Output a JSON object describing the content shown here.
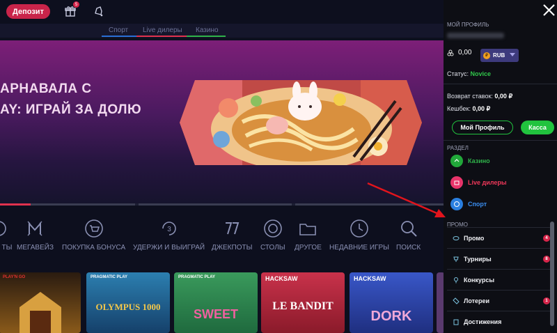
{
  "topbar": {
    "deposit_label": "Депозит",
    "gift_badge": "5"
  },
  "tabs": [
    {
      "label": "Спорт",
      "color": "#2a6fd6"
    },
    {
      "label": "Live дилеры",
      "color": "#e0324e"
    },
    {
      "label": "Казино",
      "color": "#2fb34a"
    }
  ],
  "banner": {
    "title_line1": "АРНАВАЛА С",
    "title_line2": "AY: ИГРАЙ ЗА ДОЛЮ"
  },
  "categories": [
    {
      "label": "ТЫ",
      "icon": "partial-icon"
    },
    {
      "label": "МЕГАВЕЙЗ",
      "icon": "megaways-icon"
    },
    {
      "label": "ПОКУПКА БОНУСА",
      "icon": "bonus-buy-icon"
    },
    {
      "label": "УДЕРЖИ И ВЫИГРАЙ",
      "icon": "hold-and-win-icon"
    },
    {
      "label": "ДЖЕКПОТЫ",
      "icon": "jackpot-icon"
    },
    {
      "label": "СТОЛЫ",
      "icon": "tables-icon"
    },
    {
      "label": "ДРУГОЕ",
      "icon": "folder-icon"
    },
    {
      "label": "НЕДАВНИЕ ИГРЫ",
      "icon": "clock-icon"
    },
    {
      "label": "ПОИСК",
      "icon": "search-icon"
    }
  ],
  "games": [
    {
      "provider": "PLAY'N GO",
      "title": "",
      "bg": "#2a1b10"
    },
    {
      "provider": "PRAGMATIC PLAY",
      "title": "OLYMPUS 1000",
      "bg": "#2c7fb0"
    },
    {
      "provider": "PRAGMATIC PLAY",
      "title": "SWEET",
      "bg": "#3a9a5c"
    },
    {
      "provider": "HACKSAW",
      "title": "LE BANDIT",
      "bg": "#c9324b"
    },
    {
      "provider": "HACKSAW",
      "title": "DORK",
      "bg": "#3957c8"
    },
    {
      "provider": "",
      "title": "",
      "bg": "#5a3a6e"
    }
  ],
  "panel": {
    "profile_heading": "МОЙ ПРОФИЛЬ",
    "balance": "0,00",
    "currency": "RUB",
    "currency_symbol": "₽",
    "status_label": "Статус:",
    "status_value": "Novice",
    "refund_label": "Возврат ставок:",
    "refund_value": "0,00 ₽",
    "cashback_label": "Кешбек:",
    "cashback_value": "0,00 ₽",
    "profile_button": "Мой Профиль",
    "cash_button": "Касса",
    "section_heading": "РАЗДЕЛ",
    "sections": [
      {
        "label": "Казино",
        "color": "#2fb34a",
        "icon_bg": "#21a83a"
      },
      {
        "label": "Live дилеры",
        "color": "#f0385a",
        "icon_bg": "#e8346a"
      },
      {
        "label": "Спорт",
        "color": "#3a8df0",
        "icon_bg": "#2a7fe0"
      }
    ],
    "promo_heading": "ПРОМО",
    "promo_items": [
      {
        "label": "Промо",
        "badge": "4",
        "icon": "promo-icon"
      },
      {
        "label": "Турниры",
        "badge": "8",
        "icon": "trophy-icon"
      },
      {
        "label": "Конкурсы",
        "badge": "",
        "icon": "pin-icon"
      },
      {
        "label": "Лотереи",
        "badge": "1",
        "icon": "ticket-icon"
      },
      {
        "label": "Достижения",
        "badge": "",
        "icon": "achievement-icon"
      }
    ]
  }
}
